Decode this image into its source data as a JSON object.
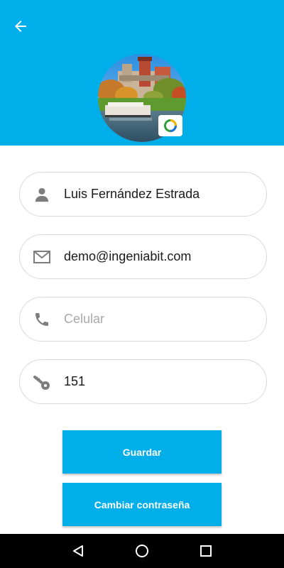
{
  "colors": {
    "primary": "#00aee9",
    "field_border": "#d9d9d9",
    "icon_gray": "#7d7d7d",
    "placeholder": "#a8a8a8",
    "navbar": "#000000"
  },
  "header": {
    "back_icon": "arrow-left-icon",
    "avatar_description_icon": "profile-photo",
    "camera_icon": "camera-icon"
  },
  "form": {
    "name": {
      "icon": "person-icon",
      "value": "Luis Fernández Estrada",
      "placeholder": ""
    },
    "email": {
      "icon": "email-icon",
      "value": "demo@ingeniabit.com",
      "placeholder": ""
    },
    "phone": {
      "icon": "phone-icon",
      "value": "",
      "placeholder": "Celular"
    },
    "code": {
      "icon": "key-icon",
      "value": "151",
      "placeholder": ""
    }
  },
  "buttons": {
    "save_label": "Guardar",
    "change_password_label": "Cambiar contraseña"
  },
  "navbar": {
    "back_icon": "nav-back-icon",
    "home_icon": "nav-home-icon",
    "recents_icon": "nav-recents-icon"
  }
}
